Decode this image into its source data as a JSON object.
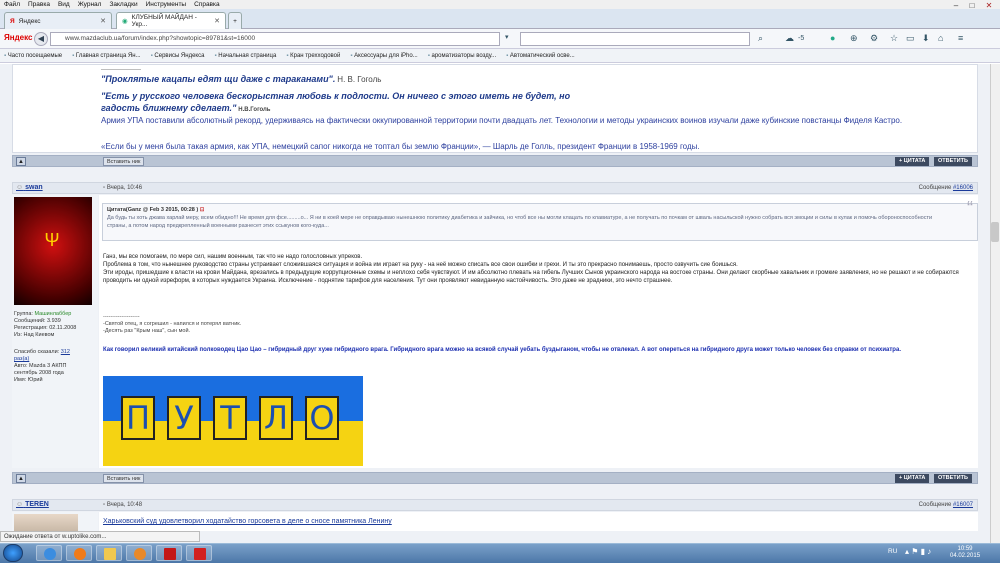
{
  "menu": [
    "Файл",
    "Правка",
    "Вид",
    "Журнал",
    "Закладки",
    "Инструменты",
    "Справка"
  ],
  "tabs": [
    {
      "label": "Яндекс"
    },
    {
      "label": "КЛУБНЫЙ МАЙДАН - Укр..."
    }
  ],
  "nav": {
    "logo": "Яндекс",
    "url": "www.mazdaclub.ua/forum/index.php?showtopic=89781&st=16000",
    "search_placeholder": "",
    "weather": "-5"
  },
  "bookmarks": [
    "Часто посещаемые",
    "Главная страница Ян...",
    "Сервисы Яндекса",
    "Начальная страница",
    "Кран трехходовой",
    "Аксессуары для iPho...",
    "ароматизаторы возду...",
    "Автоматический осве..."
  ],
  "post1": {
    "quote1": "\"Проклятые кацапы едят щи даже с тараканами\".",
    "quote1_author": "Н. В. Гоголь",
    "quote2": "\"Есть у русского человека бескорыстная любовь к подлости. Он ничего с этого иметь не будет, но гадость ближнему сделает.\"",
    "quote2_author": "Н.В.Гоголь",
    "para1": "Армия УПА поставили абсолютный рекорд, удерживаясь на фактически оккупированной территории почти двадцать лет. Технологии и методы украинских воинов изучали даже кубинские повстанцы Фиделя Кастро.",
    "para2": "«Если бы у меня была такая армия, как УПА, немецкий сапог никогда не топтал бы землю Франции», — Шарль де Голль, президент Франции в 1958-1969 годы.",
    "insert_label": "Вставить ник",
    "quote_btn": "+ ЦИТАТА",
    "reply_btn": "ОТВЕТИТЬ"
  },
  "post2": {
    "author": "swan",
    "date": "Вчера, 10:46",
    "message_label": "Сообщение",
    "message_num": "#16006",
    "user_info": {
      "group_label": "Группа:",
      "group": "Машинлаббер",
      "messages": "Сообщений: 3.939",
      "registered": "Регистрация: 02.11.2008",
      "from": "Из: Над Киевом",
      "thanks_label": "Спасибо сказали:",
      "thanks_count": "312",
      "thanks_unit": "раз(а)",
      "car": "Авто: Mazda 3 АКПП",
      "car_date": "сентябрь 2008 года",
      "name": "Имя: Юрий"
    },
    "quote_header": "Цитата(Ganz @ Feb 3 2015, 00:28 )",
    "quote_text": "Да будь ты хоть джава харлай меру, всем обидно!!! Не время для фсе.........о... Я ни в коей мере не оправдываю нынешнюю политику диабетика и зайчика, но чтоб все ны могли клацать по клавиатуре, а не получать по почкам от шваль насыльской нужно собрать вся эмоции и силы в кулак и помочь обороноспособности страны, а потом народ предкрепленный военными разнесет этих ссыкунов кого-куда...",
    "body": [
      "Ганз, мы все помогаем, по мере сил, нашим военным, так что не надо голословных упреков.",
      "Проблема в том, что нынешнее руководство страны устраивает сложившаяся ситуация и война им играет на руку - на неё можно списать все свои ошибки и грехи. И ты это прекрасно понимаешь, просто озвучить сие боишься.",
      "Эти ироды, пришедшие к власти на крови Майдана, врезались в предыдущие коррупционные схемы и неплохо себя чувствуют. И им абсолютно плевать на гибель Лучших Сынов украинского народа на востоке страны. Они делают скорбные хавальник и громкие заявления, но не решают и не собираются проводить ни одной изреформ, в которых нуждается Украина. Исключение - поднятие тарифов для населения. Тут они проявляют невиданную настойчивость. Это даже не зрадники, это нечто страшнее."
    ],
    "sig_line": "--------------------",
    "sig1": "-Святой отец, я согрешил - напился и потерял ватник.",
    "sig2": "-Десять раз \"Крым наш\", сын мой.",
    "bold_quote": "Как говорил великий китайский полководец Цао Цао – гибридный друг хуже гибридного врага. Гибридного врага можно на всякой случай уебать буздыганом, чтобы не отвлекал. А вот опереться на гибридного друга может только человек без справки от психиатра.",
    "image_letters": [
      "П",
      "У",
      "Т",
      "Л",
      "О"
    ],
    "insert_label": "Вставить ник",
    "quote_btn": "+ ЦИТАТА",
    "reply_btn": "ОТВЕТИТЬ"
  },
  "post3": {
    "author": "TEREN",
    "date": "Вчера, 10:48",
    "message_label": "Сообщение",
    "message_num": "#16007",
    "title": "Харьковский суд удовлетворил ходатайство горсовета в деле о сносе памятника Ленину"
  },
  "status": "Ожидание ответа от w.uptolike.com...",
  "taskbar": {
    "lang": "RU",
    "time": "10:59",
    "date": "04.02.2015"
  },
  "colors": {
    "accent": "#2c3f9e",
    "bar": "#b9c4d4",
    "flag_blue": "#1a6ee0",
    "flag_yellow": "#f5d312"
  }
}
